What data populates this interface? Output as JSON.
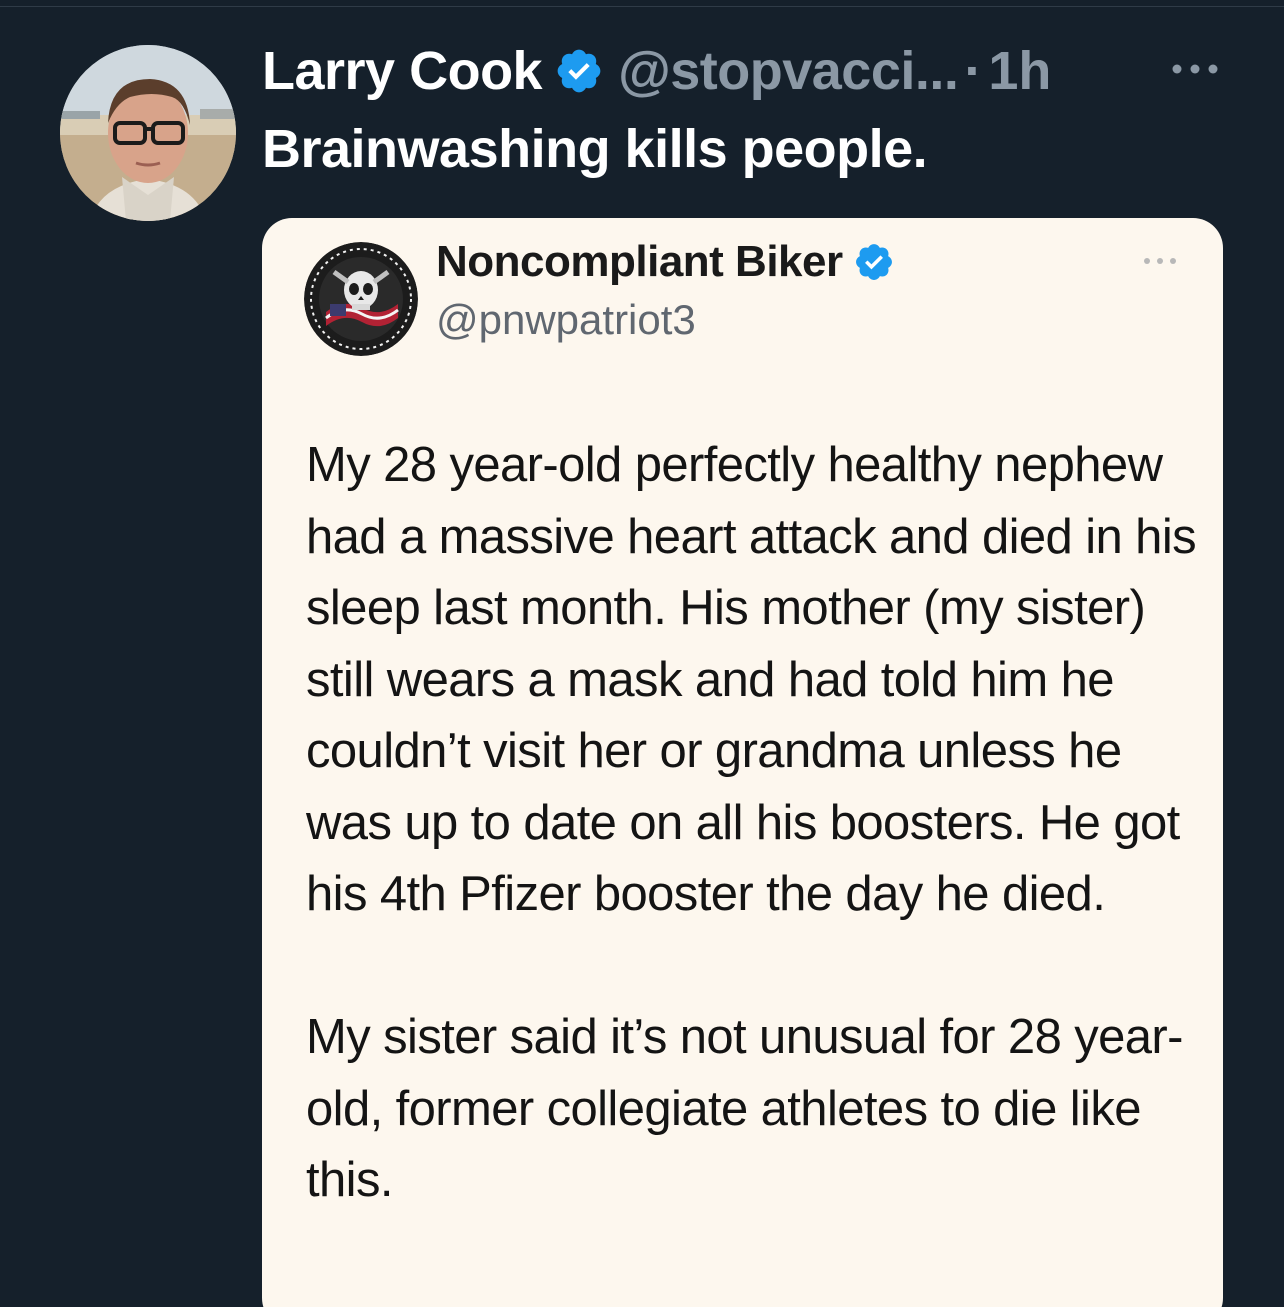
{
  "tweet": {
    "author": {
      "display_name": "Larry Cook",
      "verified": true,
      "handle": "@stopvacci...",
      "avatar_icon": "profile-photo"
    },
    "separator": "·",
    "time": "1h",
    "text": "Brainwashing kills people.",
    "more_icon": "more-options-icon"
  },
  "quoted_tweet": {
    "author": {
      "display_name": "Noncompliant Biker",
      "verified": true,
      "handle": "@pnwpatriot3",
      "avatar_icon": "skull-emblem"
    },
    "paragraphs": [
      "My 28 year-old perfectly healthy nephew had a massive heart attack and died in his sleep last month. His mother (my sister) still wears a mask and had told him he couldn’t visit her or grandma unless he was up to date on all his boosters. He got his 4th Pfizer booster the day he died.",
      "My sister said it’s not unusual for 28 year-old, former collegiate athletes to die like this."
    ]
  },
  "colors": {
    "background": "#15202b",
    "card_background": "#fdf7ee",
    "verified_blue": "#1d9bf0",
    "secondary_text": "#8b98a5"
  }
}
